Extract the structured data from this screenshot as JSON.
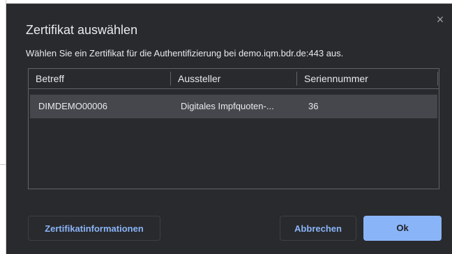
{
  "dialog": {
    "title": "Zertifikat auswählen",
    "subtitle": "Wählen Sie ein Zertifikat für die Authentifizierung bei demo.iqm.bdr.de:443 aus.",
    "close_symbol": "×"
  },
  "table": {
    "columns": [
      "Betreff",
      "Aussteller",
      "Seriennummer"
    ],
    "rows": [
      {
        "subject": "DIMDEMO00006",
        "issuer": "Digitales Impfquoten-...",
        "serial": "36",
        "selected": true
      }
    ]
  },
  "buttons": {
    "info_label": "Zertifikatinformationen",
    "cancel_label": "Abbrechen",
    "ok_label": "Ok"
  },
  "colors": {
    "dialog_background": "#292a2d",
    "selected_row": "#45474c",
    "accent": "#8ab4f8",
    "text": "#e8eaed"
  }
}
